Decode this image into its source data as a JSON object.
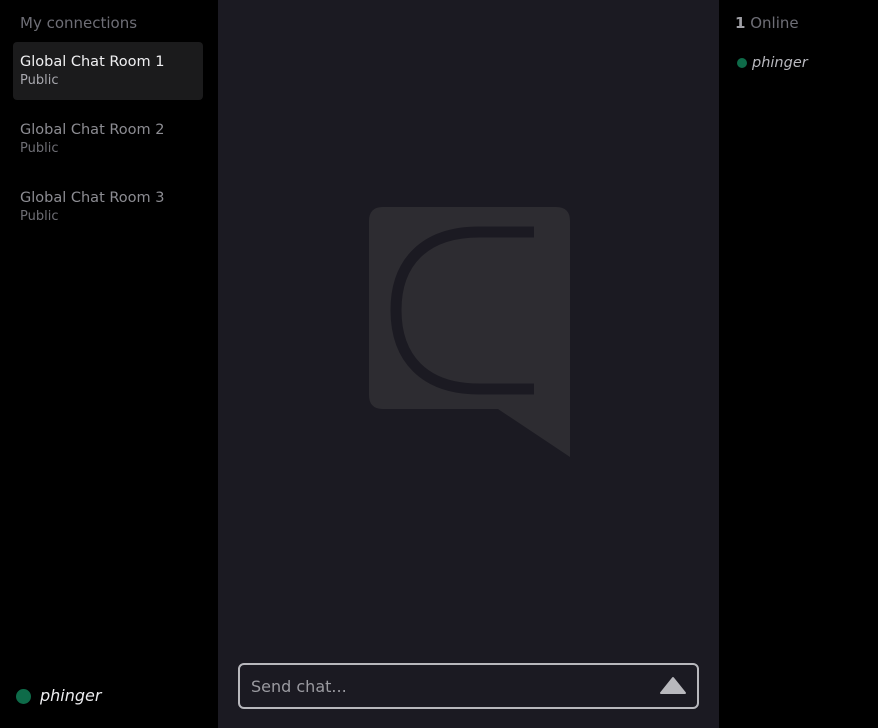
{
  "sidebar": {
    "heading": "My connections",
    "connections": [
      {
        "name": "Global Chat Room 1",
        "visibility": "Public",
        "active": true
      },
      {
        "name": "Global Chat Room 2",
        "visibility": "Public",
        "active": false
      },
      {
        "name": "Global Chat Room 3",
        "visibility": "Public",
        "active": false
      }
    ],
    "current_user": {
      "name": "phinger",
      "status_color": "#0e6b49"
    }
  },
  "chat": {
    "logo_icon": "chat-bubble-c-logo-icon",
    "composer": {
      "placeholder": "Send chat...",
      "value": "",
      "send_icon": "triangle-up-send-icon"
    }
  },
  "online": {
    "count": "1",
    "label": "Online",
    "users": [
      {
        "name": "phinger",
        "status_color": "#0e6b49"
      }
    ]
  },
  "colors": {
    "chat_background": "#1b1a22",
    "sidebar_background": "#000000",
    "active_item_background": "#1b1b1c",
    "online_status": "#0e6b49"
  }
}
